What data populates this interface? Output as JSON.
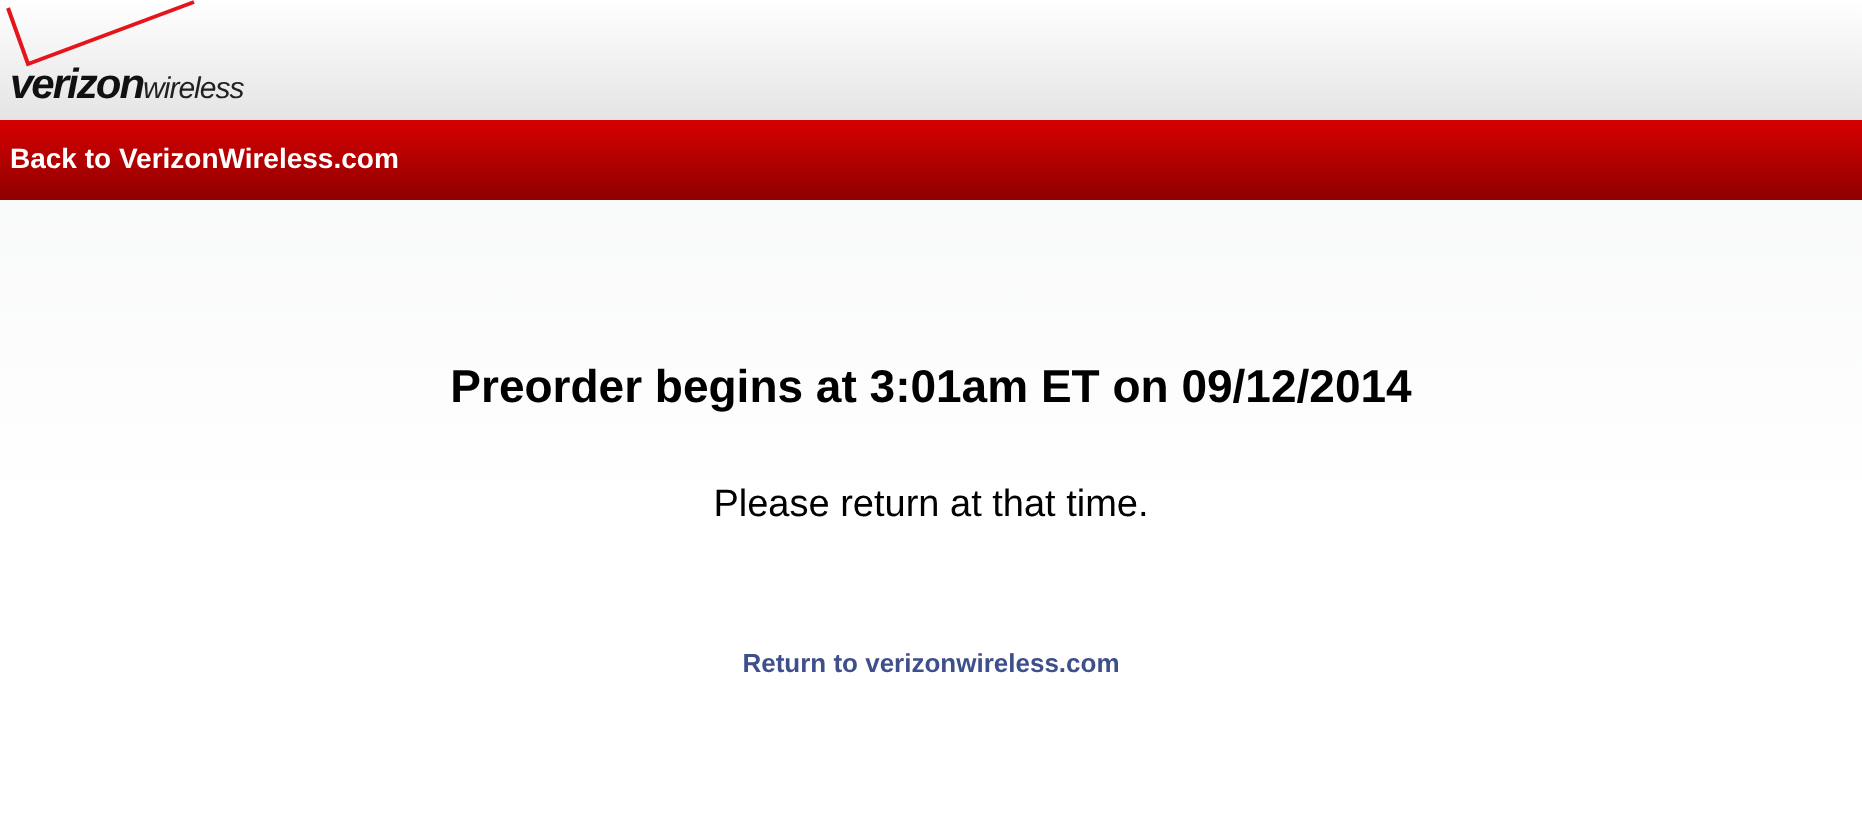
{
  "logo": {
    "brand": "verizon",
    "suffix": "wireless"
  },
  "nav_bar": {
    "link": "Back to VerizonWireless.com"
  },
  "message": {
    "heading": "Preorder begins at 3:01am ET on 09/12/2014",
    "subtext": "Please return at that time.",
    "link": "Return to verizonwireless.com"
  }
}
